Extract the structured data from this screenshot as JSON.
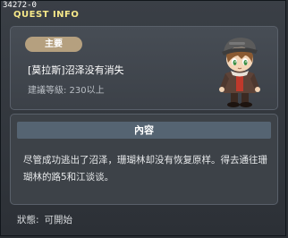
{
  "window": {
    "quest_id": "34272-0",
    "title": "QUEST INFO"
  },
  "quest": {
    "category_badge": "主要",
    "name": "[莫拉斯]沼泽没有消失",
    "level_requirement": "建議等級: 230以上",
    "portrait_icon": "npc-portrait-icon"
  },
  "content": {
    "header": "內容",
    "description": "尽管成功逃出了沼泽，珊瑚林却没有恢复原样。得去通往珊瑚林的路5和江谈谈。"
  },
  "status": {
    "label": "狀態:",
    "value": "可開始"
  },
  "colors": {
    "title": "#f6e889",
    "badge": "#b5a07f",
    "header_bar": "#556472"
  }
}
